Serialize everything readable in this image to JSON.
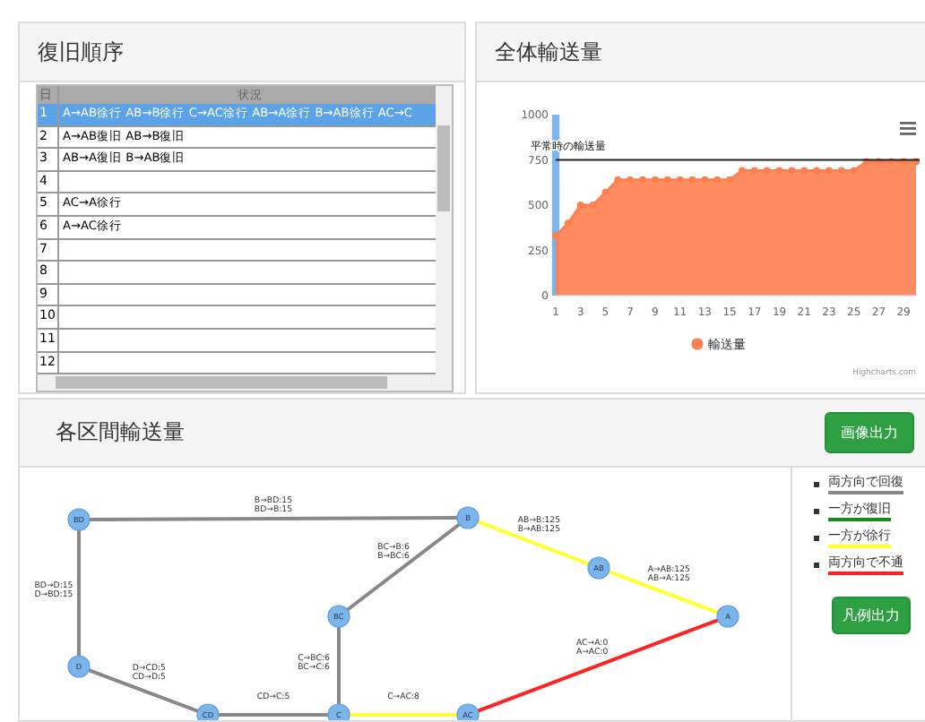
{
  "restore_panel": {
    "title": "復旧順序",
    "table": {
      "columns": [
        "日",
        "状況"
      ],
      "rows": [
        {
          "day": "1",
          "status": "A→AB徐行 AB→B徐行 C→AC徐行 AB→A徐行 B→AB徐行 AC→C",
          "selected": true
        },
        {
          "day": "2",
          "status": "A→AB復旧 AB→B復旧",
          "selected": false
        },
        {
          "day": "3",
          "status": "AB→A復旧 B→AB復旧",
          "selected": false
        },
        {
          "day": "4",
          "status": "",
          "selected": false
        },
        {
          "day": "5",
          "status": "AC→A徐行",
          "selected": false
        },
        {
          "day": "6",
          "status": "A→AC徐行",
          "selected": false
        },
        {
          "day": "7",
          "status": "",
          "selected": false
        },
        {
          "day": "8",
          "status": "",
          "selected": false
        },
        {
          "day": "9",
          "status": "",
          "selected": false
        },
        {
          "day": "10",
          "status": "",
          "selected": false
        },
        {
          "day": "11",
          "status": "",
          "selected": false
        },
        {
          "day": "12",
          "status": "",
          "selected": false
        }
      ]
    }
  },
  "total_panel": {
    "title": "全体輸送量",
    "credits": "Highcharts.com",
    "chart_data": {
      "type": "area",
      "x": [
        1,
        2,
        3,
        4,
        5,
        6,
        7,
        8,
        9,
        10,
        11,
        12,
        13,
        14,
        15,
        16,
        17,
        18,
        19,
        20,
        21,
        22,
        23,
        24,
        25,
        26,
        27,
        28,
        29,
        30
      ],
      "series": [
        {
          "name": "輸送量",
          "color": "#ff7f50",
          "values": [
            330,
            400,
            500,
            500,
            570,
            640,
            640,
            640,
            640,
            640,
            640,
            640,
            640,
            640,
            640,
            690,
            690,
            690,
            690,
            690,
            690,
            690,
            690,
            690,
            690,
            740,
            740,
            740,
            740,
            740
          ]
        }
      ],
      "xlim": [
        1,
        30
      ],
      "ylim": [
        0,
        1000
      ],
      "yticks": [
        0,
        250,
        500,
        750,
        1000
      ],
      "xticks": [
        1,
        3,
        5,
        7,
        9,
        11,
        13,
        15,
        17,
        19,
        21,
        23,
        25,
        27,
        29
      ],
      "ref_lines": [
        {
          "axis": "y",
          "value": 750,
          "label": "平常時の輸送量",
          "color": "#222222"
        }
      ],
      "bands": [
        {
          "axis": "x",
          "from": 0.7,
          "to": 1.3,
          "color": "#7cb5ec"
        }
      ]
    }
  },
  "section_panel": {
    "title": "各区間輸送量",
    "export_button": "画像出力",
    "legend_button": "凡例出力",
    "legend": [
      {
        "label": "両方向で回復",
        "color": "#888888"
      },
      {
        "label": "一方が復旧",
        "color": "#1a8a1a"
      },
      {
        "label": "一方が徐行",
        "color": "#ffff33"
      },
      {
        "label": "両方向で不通",
        "color": "#ff2222"
      }
    ],
    "nodes": [
      {
        "label": "BD"
      },
      {
        "label": "B"
      },
      {
        "label": "BC"
      },
      {
        "label": "D"
      },
      {
        "label": "CD"
      },
      {
        "label": "C"
      },
      {
        "label": "AC"
      },
      {
        "label": "AB"
      },
      {
        "label": "A"
      }
    ],
    "edges": [
      {
        "color": "#888888",
        "labels": [
          "B→BD:15",
          "BD→B:15"
        ]
      },
      {
        "color": "#888888",
        "labels": [
          "BD→D:15",
          "D→BD:15"
        ]
      },
      {
        "color": "#888888",
        "labels": [
          "D→CD:5",
          "CD→D:5"
        ]
      },
      {
        "color": "#888888",
        "labels": [
          "CD→C:5"
        ]
      },
      {
        "color": "#888888",
        "labels": [
          "BC→B:6",
          "B→BC:6"
        ]
      },
      {
        "color": "#888888",
        "labels": [
          "C→BC:6",
          "BC→C:6"
        ]
      },
      {
        "color": "#ffff33",
        "labels": [
          "C→AC:8"
        ]
      },
      {
        "color": "#ffff33",
        "labels": [
          "AB→B:125",
          "B→AB:125"
        ]
      },
      {
        "color": "#ffff33",
        "labels": [
          "A→AB:125",
          "AB→A:125"
        ]
      },
      {
        "color": "#ff2222",
        "labels": [
          "AC→A:0",
          "A→AC:0"
        ]
      }
    ]
  }
}
